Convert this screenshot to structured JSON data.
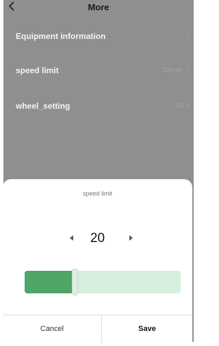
{
  "header": {
    "title": "More"
  },
  "settings": [
    {
      "label": "Equipment information",
      "value": ""
    },
    {
      "label": "speed limit",
      "value": "25km/h"
    },
    {
      "label": "wheel_setting",
      "value": "20"
    }
  ],
  "dialog": {
    "title": "speed limit",
    "value": "20",
    "slider_level": 0.31,
    "cancel_label": "Cancel",
    "save_label": "Save"
  },
  "icons": {
    "back": "chevron-left-icon",
    "row_arrow": "chevron-right-icon",
    "decrement": "triangle-left-icon",
    "increment": "triangle-right-icon"
  },
  "colors": {
    "overlay": "#8f8f8f",
    "slider_fill": "#4ea565",
    "slider_track": "#d8eedf"
  }
}
